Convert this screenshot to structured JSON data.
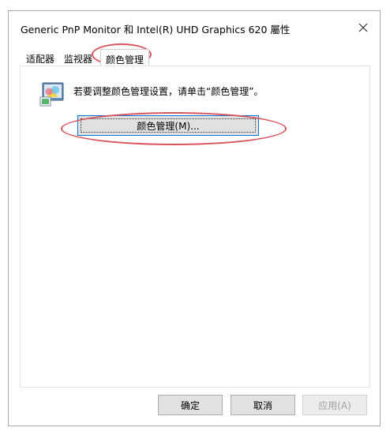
{
  "dialog": {
    "title": "Generic PnP Monitor 和 Intel(R) UHD Graphics 620 屬性",
    "close_icon": "close-icon"
  },
  "tabs": [
    {
      "label": "适配器",
      "active": false
    },
    {
      "label": "监视器",
      "active": false
    },
    {
      "label": "颜色管理",
      "active": true
    }
  ],
  "color_management": {
    "icon": "color-management-icon",
    "description": "若要调整颜色管理设置，请单击“颜色管理”。",
    "button_label": "颜色管理(M)..."
  },
  "footer": {
    "ok_label": "确定",
    "cancel_label": "取消",
    "apply_label": "应用(A)",
    "apply_enabled": false
  },
  "annotation_color": "#d9545c"
}
